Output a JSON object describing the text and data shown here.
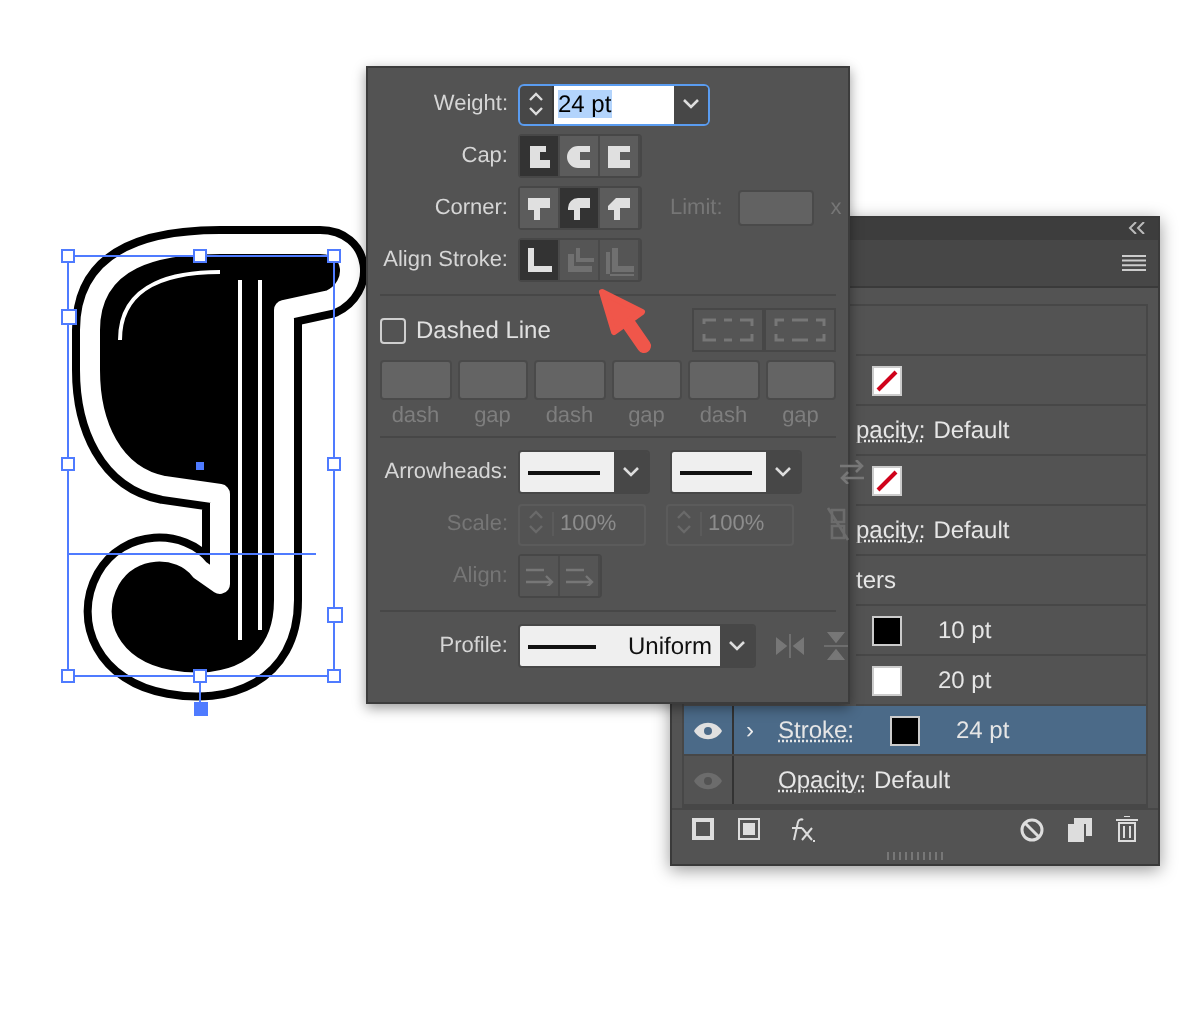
{
  "stroke_popup": {
    "weight": {
      "label": "Weight:",
      "value": "24 pt"
    },
    "cap": {
      "label": "Cap:",
      "options": [
        {
          "kind": "butt",
          "selected": true
        },
        {
          "kind": "round",
          "selected": false
        },
        {
          "kind": "square",
          "selected": false
        }
      ]
    },
    "corner": {
      "label": "Corner:",
      "options": [
        {
          "kind": "miter",
          "selected": false
        },
        {
          "kind": "round",
          "selected": true
        },
        {
          "kind": "bevel",
          "selected": false
        }
      ],
      "limit_label": "Limit:",
      "limit_suffix": "x",
      "limit_disabled": true
    },
    "align_stroke": {
      "label": "Align Stroke:",
      "options": [
        {
          "kind": "center",
          "selected": true,
          "disabled": false
        },
        {
          "kind": "inside",
          "selected": false,
          "disabled": true
        },
        {
          "kind": "outside",
          "selected": false,
          "disabled": true
        }
      ]
    },
    "dashed_line": {
      "label": "Dashed Line",
      "checked": false
    },
    "dash_fields": [
      "dash",
      "gap",
      "dash",
      "gap",
      "dash",
      "gap"
    ],
    "arrowheads": {
      "label": "Arrowheads:"
    },
    "scale": {
      "label": "Scale:",
      "values": [
        "100%",
        "100%"
      ],
      "disabled": true
    },
    "align": {
      "label": "Align:",
      "disabled": true
    },
    "profile": {
      "label": "Profile:",
      "value": "Uniform"
    }
  },
  "appearance_panel": {
    "rows": [
      {
        "kind": "partial",
        "selected": false
      },
      {
        "kind": "partial",
        "selected": false,
        "swatch": {
          "kind": "none"
        }
      },
      {
        "kind": "partial",
        "selected": false,
        "label": "pacity:",
        "value": "Default"
      },
      {
        "kind": "partial",
        "selected": false,
        "swatch": {
          "kind": "none"
        }
      },
      {
        "kind": "partial",
        "selected": false,
        "label": "pacity:",
        "value": "Default"
      },
      {
        "kind": "partial",
        "selected": false,
        "heading": "ters"
      },
      {
        "kind": "partial",
        "selected": false,
        "swatch": {
          "kind": "fill",
          "color": "#000000"
        },
        "value": "10 pt"
      },
      {
        "kind": "partial",
        "selected": false,
        "swatch": {
          "kind": "fill",
          "color": "#ffffff"
        },
        "value": "20 pt"
      },
      {
        "kind": "full",
        "selected": true,
        "eye_dimmed": false,
        "expander": "›",
        "label": "Stroke:",
        "swatch": {
          "kind": "fill",
          "color": "#000000"
        },
        "value": "24 pt"
      },
      {
        "kind": "full",
        "selected": false,
        "eye_dimmed": true,
        "label": "Opacity:",
        "value": "Default"
      }
    ]
  }
}
